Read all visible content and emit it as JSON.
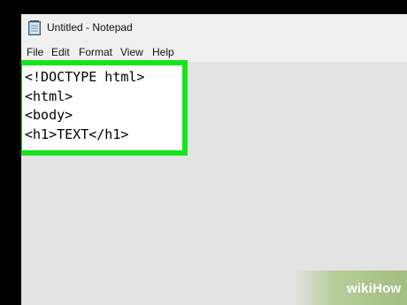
{
  "window": {
    "title": "Untitled - Notepad"
  },
  "menu": [
    "File",
    "Edit",
    "Format",
    "View",
    "Help"
  ],
  "editor": {
    "lines": [
      "<!DOCTYPE html>",
      "<html>",
      "<body>",
      "<h1>TEXT</h1>"
    ]
  },
  "highlight": {
    "color": "#17e31d"
  },
  "watermark": {
    "text": "wikiHow"
  }
}
